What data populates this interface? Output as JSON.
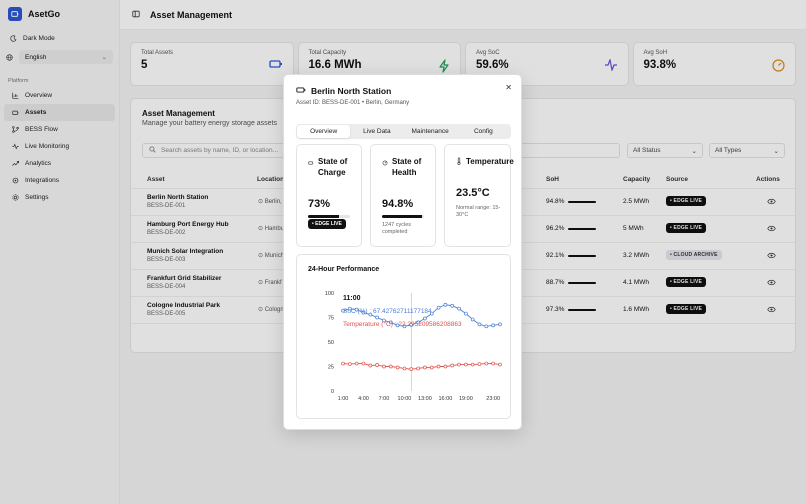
{
  "app": {
    "name": "AsetGo"
  },
  "sidebar": {
    "dark_mode_label": "Dark Mode",
    "language": "English",
    "section_label": "Platform",
    "items": [
      {
        "label": "Overview",
        "icon": "overview-icon"
      },
      {
        "label": "Assets",
        "icon": "assets-icon",
        "active": true
      },
      {
        "label": "BESS Flow",
        "icon": "flow-icon"
      },
      {
        "label": "Live Monitoring",
        "icon": "monitoring-icon"
      },
      {
        "label": "Analytics",
        "icon": "analytics-icon"
      },
      {
        "label": "Integrations",
        "icon": "integrations-icon"
      },
      {
        "label": "Settings",
        "icon": "settings-icon"
      }
    ]
  },
  "header": {
    "title": "Asset Management"
  },
  "stats": [
    {
      "label": "Total Assets",
      "value": "5",
      "icon": "battery-icon",
      "color": "#2c57d6"
    },
    {
      "label": "Total Capacity",
      "value": "16.6 MWh",
      "icon": "bolt-icon",
      "color": "#22a35a"
    },
    {
      "label": "Avg SoC",
      "value": "59.6%",
      "icon": "activity-icon",
      "color": "#6b4fd8"
    },
    {
      "label": "Avg SoH",
      "value": "93.8%",
      "icon": "gauge-icon",
      "color": "#e08a17"
    }
  ],
  "assets_panel": {
    "title": "Asset Management",
    "subtitle": "Manage your battery energy storage assets",
    "search_placeholder": "Search assets by name, ID, or location...",
    "status_filter": "All Status",
    "type_filter": "All Types",
    "columns": {
      "asset": "Asset",
      "location": "Location",
      "soh": "SoH",
      "capacity": "Capacity",
      "source": "Source",
      "actions": "Actions"
    },
    "rows": [
      {
        "name": "Berlin North Station",
        "id": "BESS-DE-001",
        "location": "Berlin,",
        "soh": "94.8%",
        "capacity": "2.5 MWh",
        "source": "EDGE LIVE"
      },
      {
        "name": "Hamburg Port Energy Hub",
        "id": "BESS-DE-002",
        "location": "Hambu",
        "soh": "96.2%",
        "capacity": "5 MWh",
        "source": "EDGE LIVE"
      },
      {
        "name": "Munich Solar Integration",
        "id": "BESS-DE-003",
        "location": "Munich",
        "soh": "92.1%",
        "capacity": "3.2 MWh",
        "source": "CLOUD ARCHIVE"
      },
      {
        "name": "Frankfurt Grid Stabilizer",
        "id": "BESS-DE-004",
        "location": "Frankf",
        "soh": "88.7%",
        "capacity": "4.1 MWh",
        "source": "EDGE LIVE"
      },
      {
        "name": "Cologne Industrial Park",
        "id": "BESS-DE-005",
        "location": "Cologn",
        "soh": "97.3%",
        "capacity": "1.6 MWh",
        "source": "EDGE LIVE"
      }
    ]
  },
  "modal": {
    "title": "Berlin North Station",
    "subtitle": "Asset ID: BESS-DE-001 • Berlin, Germany",
    "tabs": [
      "Overview",
      "Live Data",
      "Maintenance",
      "Config"
    ],
    "soc": {
      "label": "State of Charge",
      "value": "73%",
      "fill": 0.73,
      "badge": "EDGE LIVE"
    },
    "soh": {
      "label": "State of Health",
      "value": "94.8%",
      "fill": 0.948,
      "note": "1247 cycles completed"
    },
    "temp": {
      "label": "Temperature",
      "value": "23.5°C",
      "note": "Normal range: 15-30°C"
    },
    "perf_title": "24-Hour Performance",
    "tooltip": {
      "time": "11:00",
      "soc_line": "SoC (%) : 67.42762711177184",
      "temp_line": "Temperature (°C) : 22.295209586208863"
    }
  },
  "chart_data": {
    "type": "line",
    "title": "24-Hour Performance",
    "x": [
      "1:00",
      "2:00",
      "3:00",
      "4:00",
      "5:00",
      "6:00",
      "7:00",
      "8:00",
      "9:00",
      "10:00",
      "11:00",
      "12:00",
      "13:00",
      "14:00",
      "15:00",
      "16:00",
      "17:00",
      "18:00",
      "19:00",
      "20:00",
      "21:00",
      "22:00",
      "23:00",
      "24:00"
    ],
    "x_ticks": [
      "1:00",
      "4:00",
      "7:00",
      "10:00",
      "13:00",
      "16:00",
      "19:00",
      "23:00"
    ],
    "ylim": [
      0,
      100
    ],
    "y_ticks": [
      0,
      25,
      50,
      75,
      100
    ],
    "series": [
      {
        "name": "SoC (%)",
        "color": "#4a7fd6",
        "values": [
          82,
          84,
          83,
          80,
          78,
          75,
          72,
          70,
          67,
          66,
          67.4,
          70,
          74,
          79,
          85,
          88,
          87,
          84,
          79,
          73,
          68,
          66,
          67,
          68
        ]
      },
      {
        "name": "Temperature (°C)",
        "color": "#e0524a",
        "values": [
          28,
          27.5,
          28,
          28,
          26,
          26.5,
          25,
          25,
          24,
          23,
          22.3,
          23,
          24,
          24,
          25,
          25,
          26,
          27,
          27,
          27,
          27.5,
          28,
          28,
          27
        ]
      }
    ],
    "grid": false,
    "cursor_x": "11:00"
  }
}
